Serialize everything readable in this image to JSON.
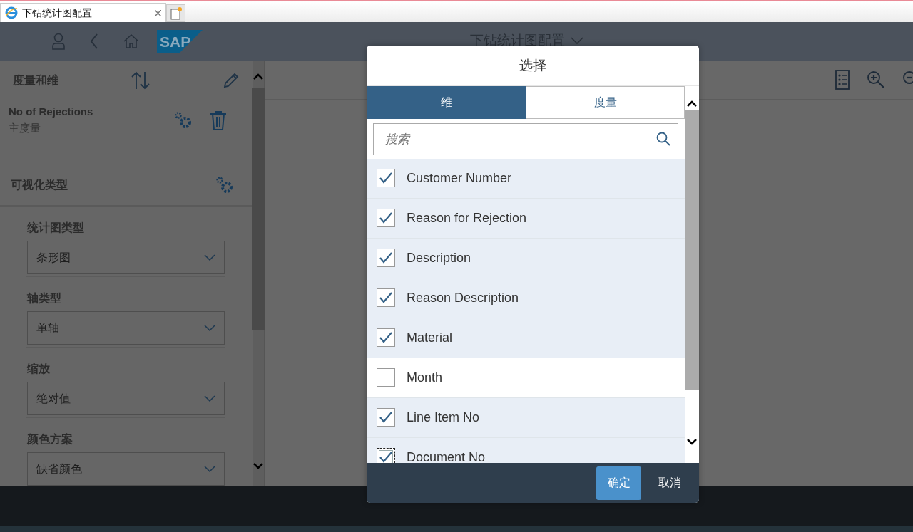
{
  "browser_tab": {
    "title": "下钻统计图配置"
  },
  "shell": {
    "logo": "SAP",
    "title": "下钻统计图配置"
  },
  "side_panel": {
    "title": "度量和维",
    "measures": [
      {
        "name": "No of Rejections",
        "role": "主度量"
      }
    ],
    "visualization": {
      "title": "可视化类型",
      "fields": [
        {
          "label": "统计图类型",
          "value": "条形图"
        },
        {
          "label": "轴类型",
          "value": "单轴"
        },
        {
          "label": "缩放",
          "value": "绝对值"
        },
        {
          "label": "颜色方案",
          "value": "缺省颜色"
        }
      ]
    }
  },
  "dialog": {
    "title": "选择",
    "tabs": [
      {
        "label": "维",
        "selected": true
      },
      {
        "label": "度量",
        "selected": false
      }
    ],
    "search": {
      "placeholder": "搜索"
    },
    "items": [
      {
        "label": "Customer Number",
        "checked": true,
        "focused": false
      },
      {
        "label": "Reason for Rejection",
        "checked": true,
        "focused": false
      },
      {
        "label": "Description",
        "checked": true,
        "focused": false
      },
      {
        "label": "Reason Description",
        "checked": true,
        "focused": false
      },
      {
        "label": "Material",
        "checked": true,
        "focused": false
      },
      {
        "label": "Month",
        "checked": false,
        "focused": false
      },
      {
        "label": "Line Item No",
        "checked": true,
        "focused": false
      },
      {
        "label": "Document No",
        "checked": true,
        "focused": true
      }
    ],
    "buttons": [
      {
        "label": "确定",
        "kind": "primary"
      },
      {
        "label": "取消",
        "kind": "plain"
      }
    ]
  }
}
